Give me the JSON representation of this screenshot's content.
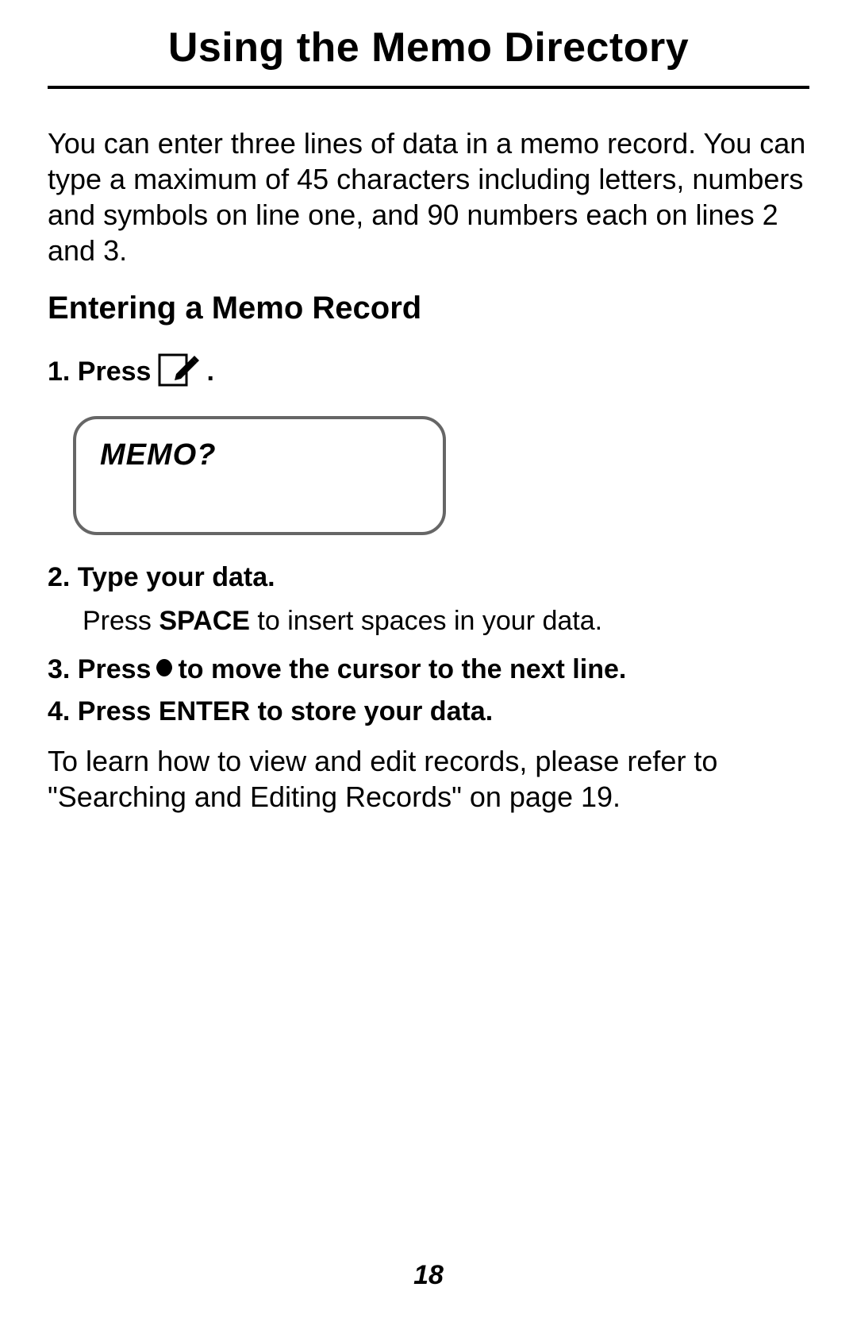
{
  "title": "Using the Memo Directory",
  "intro": "You can enter three lines of data in a memo record. You can type a maximum of 45 characters including letters, numbers and symbols on line one, and 90 numbers each on lines 2 and 3.",
  "subheading": "Entering a Memo Record",
  "steps": {
    "s1_prefix": "1. Press ",
    "s1_suffix": " .",
    "display": "MEMO?",
    "s2": "2. Type your data.",
    "s2_sub_pre": "Press ",
    "s2_sub_kw": "SPACE",
    "s2_sub_post": " to insert spaces in your data.",
    "s3_prefix": "3. Press ",
    "s3_suffix": " to move the cursor to the next line.",
    "s4": "4. Press ENTER to store your data."
  },
  "closing": "To learn how to view and edit records, please refer to \"Searching and Editing Records\" on page 19.",
  "page_number": "18"
}
